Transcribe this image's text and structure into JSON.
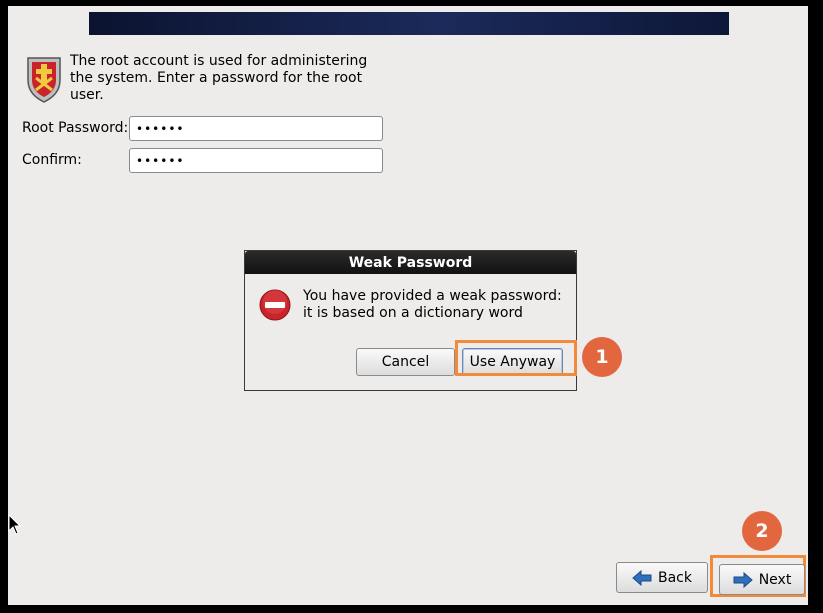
{
  "header": {
    "banner_color": "#1b2a5a"
  },
  "intro": {
    "text": "The root account is used for administering the system.  Enter a password for the root user."
  },
  "form": {
    "root_password": {
      "label": "Root Password:",
      "value": "••••••"
    },
    "confirm": {
      "label": "Confirm:",
      "value": "••••••"
    }
  },
  "dialog": {
    "title": "Weak Password",
    "message": "You have provided a weak password: it is based on a dictionary word",
    "cancel_label": "Cancel",
    "use_anyway_label": "Use Anyway"
  },
  "annotations": {
    "step1": "1",
    "step2": "2",
    "highlight_color": "#f28a3a",
    "badge_color": "#e2673f"
  },
  "nav": {
    "back_label": "Back",
    "next_label": "Next"
  },
  "icons": [
    "root-shield-icon",
    "stop-icon",
    "back-arrow-icon",
    "next-arrow-icon",
    "mouse-cursor-icon"
  ]
}
